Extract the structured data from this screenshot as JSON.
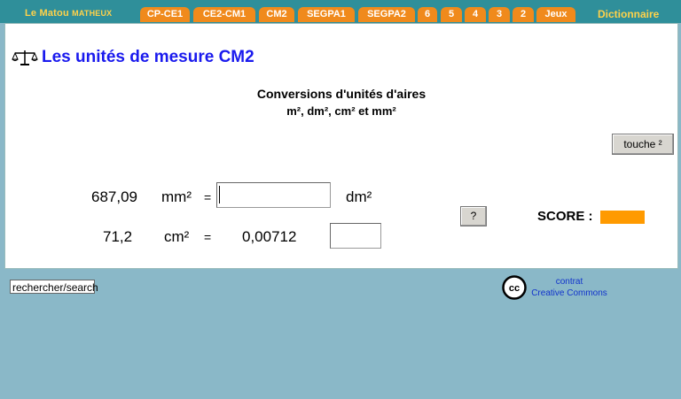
{
  "nav": {
    "brand_main": "Le Matou",
    "brand_small": "matheux",
    "tabs": [
      "CP-CE1",
      "CE2-CM1",
      "CM2",
      "SEGPA1",
      "SEGPA2",
      "6",
      "5",
      "4",
      "3",
      "2",
      "Jeux"
    ],
    "dictionary": "Dictionnaire"
  },
  "header": {
    "title": "Les unités de mesure CM2",
    "subtitle": "Conversions d'unités d'aires",
    "units_line": "m², dm², cm² et mm²"
  },
  "touch_button": "touche ²",
  "help_button": "?",
  "exercise": {
    "row1": {
      "value": "687,09",
      "unit": "mm²",
      "eq": "=",
      "input_value": "",
      "target_unit": "dm²"
    },
    "row2": {
      "value": "71,2",
      "unit": "cm²",
      "eq": "=",
      "result": "0,00712",
      "input_value": ""
    }
  },
  "score": {
    "label": "SCORE :",
    "color": "#ff9a00"
  },
  "search": {
    "text": "rechercher/search"
  },
  "license": {
    "line1": "contrat",
    "line2": "Creative Commons"
  },
  "colors": {
    "nav_bg": "#2f8f9a",
    "tab_bg": "#f08a1c",
    "brand": "#ffd24a",
    "title": "#1a1aee",
    "page_bg": "#8ab8c8"
  }
}
